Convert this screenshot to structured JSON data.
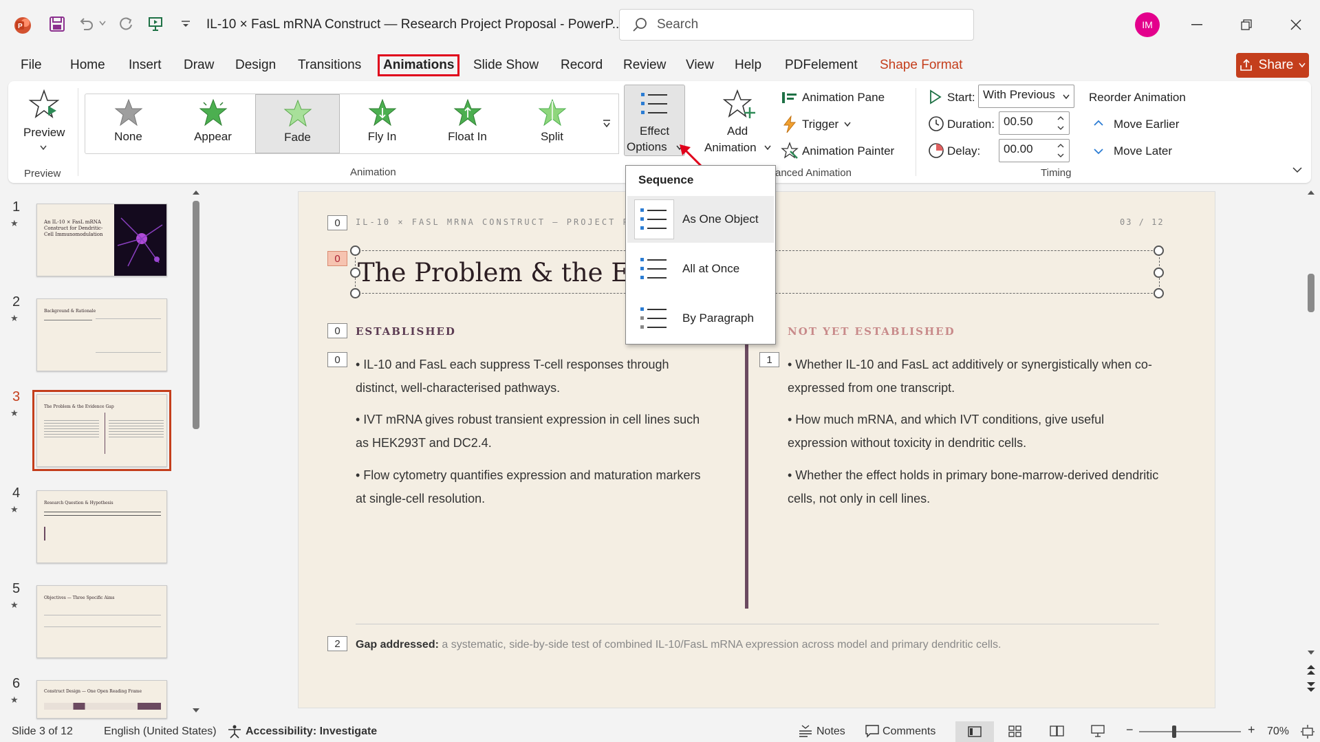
{
  "titlebar": {
    "title": "IL-10 × FasL mRNA Construct — Research Project Proposal  -  PowerP...",
    "search_placeholder": "Search",
    "avatar": "IM"
  },
  "tabs": [
    "File",
    "Home",
    "Insert",
    "Draw",
    "Design",
    "Transitions",
    "Animations",
    "Slide Show",
    "Record",
    "Review",
    "View",
    "Help",
    "PDFelement",
    "Shape Format"
  ],
  "active_tab": "Animations",
  "share_label": "Share",
  "ribbon": {
    "preview_label": "Preview",
    "preview_group": "Preview",
    "gallery": [
      {
        "label": "None",
        "color": "#9e9e9e"
      },
      {
        "label": "Appear",
        "color": "#4caf50"
      },
      {
        "label": "Fade",
        "color": "#7ccf6c"
      },
      {
        "label": "Fly In",
        "color": "#4caf50"
      },
      {
        "label": "Float In",
        "color": "#4caf50"
      },
      {
        "label": "Split",
        "color": "#8fd67c"
      }
    ],
    "selected_animation": "Fade",
    "animation_group": "Animation",
    "effect_options_line1": "Effect",
    "effect_options_line2": "Options",
    "add_animation_line1": "Add",
    "add_animation_line2": "Animation",
    "animation_pane": "Animation Pane",
    "trigger": "Trigger",
    "animation_painter": "Animation Painter",
    "advanced_group": "anced Animation",
    "start_label": "Start:",
    "start_value": "With Previous",
    "duration_label": "Duration:",
    "duration_value": "00.50",
    "delay_label": "Delay:",
    "delay_value": "00.00",
    "timing_group": "Timing",
    "reorder_label": "Reorder Animation",
    "move_earlier": "Move Earlier",
    "move_later": "Move Later"
  },
  "thumbnails": [
    {
      "num": "1",
      "title": "An IL-10 × FasL mRNA Construct for Dendritic-Cell Immunomodulation"
    },
    {
      "num": "2",
      "title": "Background & Rationale"
    },
    {
      "num": "3",
      "title": "The Problem & the Evidence Gap"
    },
    {
      "num": "4",
      "title": "Research Question & Hypothesis"
    },
    {
      "num": "5",
      "title": "Objectives — Three Specific Aims"
    },
    {
      "num": "6",
      "title": "Construct Design — One Open Reading Frame"
    }
  ],
  "slide": {
    "header_left": "IL-10 × FASL MRNA CONSTRUCT — PROJECT PROP",
    "header_right": "03 / 12",
    "title": "The Problem & the Evid",
    "established_head": "ESTABLISHED",
    "not_established_head": "NOT YET ESTABLISHED",
    "established": [
      "• IL-10 and FasL each suppress T-cell responses through distinct, well-characterised pathways.",
      "• IVT mRNA gives robust transient expression in cell lines such as HEK293T and DC2.4.",
      "• Flow cytometry quantifies expression and maturation markers at single-cell resolution."
    ],
    "not_established": [
      "• Whether IL-10 and FasL act additively or synergistically when co-expressed from one transcript.",
      "• How much mRNA, and which IVT conditions, give useful expression without toxicity in dendritic cells.",
      "• Whether the effect holds in primary bone-marrow-derived dendritic cells, not only in cell lines."
    ],
    "gap_label": "Gap addressed:",
    "gap_text": " a systematic, side-by-side test of combined IL-10/FasL mRNA expression across model and primary dendritic cells.",
    "tags": {
      "header": "0",
      "title": "0",
      "established": "0",
      "bullets_left": "0",
      "bullets_right": "1",
      "gap": "2"
    }
  },
  "dropdown": {
    "header": "Sequence",
    "items": [
      "As One Object",
      "All at Once",
      "By Paragraph"
    ],
    "highlighted": "As One Object"
  },
  "status": {
    "slide": "Slide 3 of 12",
    "language": "English (United States)",
    "accessibility": "Accessibility: Investigate",
    "notes": "Notes",
    "comments": "Comments",
    "zoom": "70%"
  }
}
